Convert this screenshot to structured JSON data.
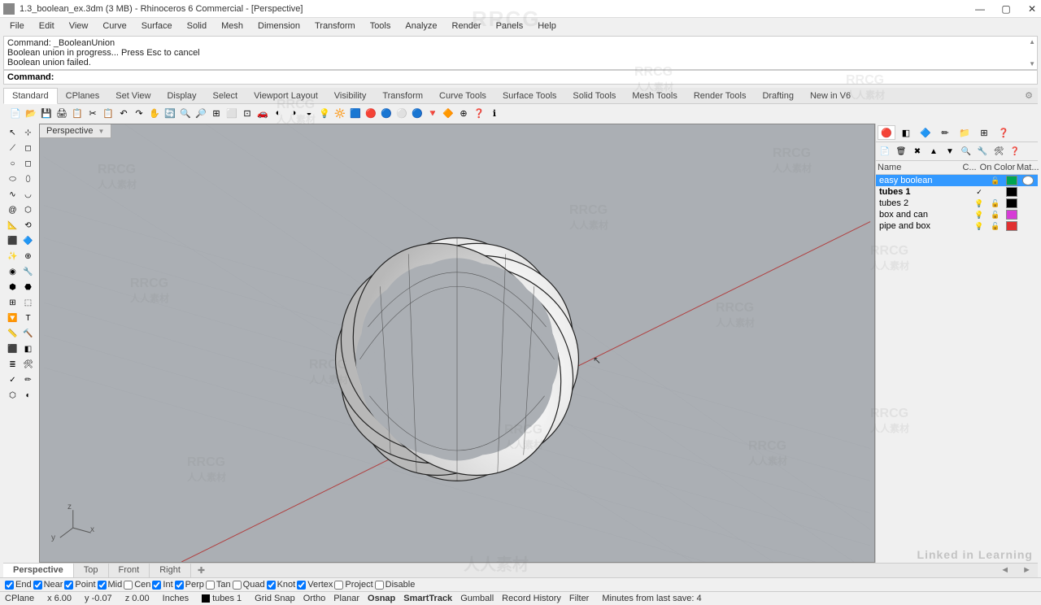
{
  "window": {
    "title": "1.3_boolean_ex.3dm (3 MB) - Rhinoceros 6 Commercial - [Perspective]"
  },
  "menu": [
    "File",
    "Edit",
    "View",
    "Curve",
    "Surface",
    "Solid",
    "Mesh",
    "Dimension",
    "Transform",
    "Tools",
    "Analyze",
    "Render",
    "Panels",
    "Help"
  ],
  "command_log": [
    "Command: _BooleanUnion",
    "Boolean union in progress... Press Esc to cancel",
    "Boolean union failed."
  ],
  "command_prompt": "Command:",
  "command_value": "",
  "ribbon_tabs": [
    "Standard",
    "CPlanes",
    "Set View",
    "Display",
    "Select",
    "Viewport Layout",
    "Visibility",
    "Transform",
    "Curve Tools",
    "Surface Tools",
    "Solid Tools",
    "Mesh Tools",
    "Render Tools",
    "Drafting",
    "New in V6"
  ],
  "active_ribbon": "Standard",
  "viewport_label": "Perspective",
  "layer_header": {
    "name": "Name",
    "c": "C...",
    "on": "On",
    "color": "Color",
    "mat": "Mat..."
  },
  "layers": [
    {
      "name": "easy boolean",
      "current": false,
      "on": true,
      "selected": true,
      "color": "#00a651",
      "mat": "#ffffff"
    },
    {
      "name": "tubes 1",
      "current": true,
      "on": true,
      "selected": false,
      "bold": true,
      "color": "#000000",
      "mat": ""
    },
    {
      "name": "tubes 2",
      "current": false,
      "on": true,
      "selected": false,
      "color": "#000000",
      "mat": ""
    },
    {
      "name": "box and can",
      "current": false,
      "on": true,
      "selected": false,
      "color": "#d63cd6",
      "mat": ""
    },
    {
      "name": "pipe and box",
      "current": false,
      "on": true,
      "selected": false,
      "color": "#e03030",
      "mat": ""
    }
  ],
  "viewport_tabs": [
    "Perspective",
    "Top",
    "Front",
    "Right"
  ],
  "active_viewport_tab": "Perspective",
  "osnaps": [
    {
      "label": "End",
      "checked": true
    },
    {
      "label": "Near",
      "checked": true
    },
    {
      "label": "Point",
      "checked": true
    },
    {
      "label": "Mid",
      "checked": true
    },
    {
      "label": "Cen",
      "checked": false
    },
    {
      "label": "Int",
      "checked": true
    },
    {
      "label": "Perp",
      "checked": true
    },
    {
      "label": "Tan",
      "checked": false
    },
    {
      "label": "Quad",
      "checked": false
    },
    {
      "label": "Knot",
      "checked": true
    },
    {
      "label": "Vertex",
      "checked": true
    },
    {
      "label": "Project",
      "checked": false
    },
    {
      "label": "Disable",
      "checked": false
    }
  ],
  "status": {
    "cplane": "CPlane",
    "x": "x 6.00",
    "y": "y -0.07",
    "z": "z 0.00",
    "units": "Inches",
    "layer": "tubes 1",
    "modes": [
      "Grid Snap",
      "Ortho",
      "Planar",
      "Osnap",
      "SmartTrack",
      "Gumball",
      "Record History",
      "Filter"
    ],
    "active_modes": [
      "Osnap",
      "SmartTrack"
    ],
    "last_save": "Minutes from last save: 4"
  },
  "watermark_top": "RRCG",
  "watermark_sub": "人人素材",
  "linkedin": "Linked in Learning",
  "axis": {
    "x": "x",
    "y": "y",
    "z": "z"
  }
}
